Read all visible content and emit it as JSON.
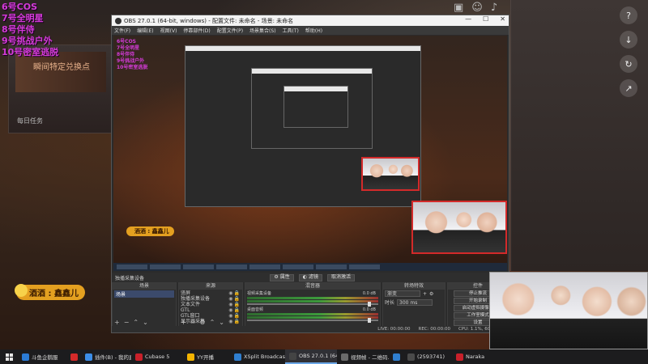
{
  "overlay_list": [
    "6号COS",
    "7号全明星",
    "8号伴侍",
    "9号挑战户外",
    "10号密室逃脱"
  ],
  "name_tag": "酒酒 : 鑫鑫儿",
  "bg_room": {
    "poster_text": "瞬间特定兑换点",
    "small_label": "每日任务"
  },
  "obs": {
    "title": "OBS 27.0.1 (64-bit, windows) - 配置文件: 未命名 - 场景: 未命名",
    "menu": [
      "文件(F)",
      "编辑(E)",
      "视图(V)",
      "停靠部件(D)",
      "配置文件(P)",
      "场景集合(S)",
      "工具(T)",
      "帮助(H)"
    ],
    "toolbar": {
      "label": "独播采集设备",
      "properties": "属性",
      "filters": "滤镜",
      "deactivate": "取消激活"
    },
    "docks": {
      "scenes": {
        "header": "场景",
        "items": [
          "场景"
        ]
      },
      "sources": {
        "header": "来源",
        "items": [
          "竖屏",
          "独播采集设备",
          "文本文件",
          "GTL",
          "GTL窗口",
          "显示器采集"
        ]
      },
      "mixer": {
        "header": "混音器",
        "tracks": [
          {
            "name": "视频采集设备",
            "db": "0.0 dB"
          },
          {
            "name": "桌面音频",
            "db": "0.0 dB"
          }
        ]
      },
      "transitions": {
        "header": "转场特效",
        "type": "渐变",
        "duration_label": "时长",
        "duration": "300 ms"
      },
      "controls": {
        "header": "控件",
        "buttons": [
          "停止推流",
          "开始录制",
          "启动虚拟摄像机",
          "工作室模式",
          "设置",
          "退出"
        ]
      }
    },
    "status": {
      "live": "LIVE: 00:00:00",
      "rec": "REC: 00:00:00",
      "cpu": "CPU: 1.1%, 60.00 fps"
    }
  },
  "taskbar": [
    {
      "label": "斗鱼企鹅服",
      "color": "#2b7cd6"
    },
    {
      "label": "",
      "color": "#d32a2a"
    },
    {
      "label": "插件(B) - 我的直...",
      "color": "#3c8ee8"
    },
    {
      "label": "Cubase 5",
      "color": "#c8202a"
    },
    {
      "label": "YY开播",
      "color": "#f4b400"
    },
    {
      "label": "XSplit Broadcas...",
      "color": "#2f7fd0"
    },
    {
      "label": "OBS 27.0.1 (64...",
      "color": "#444"
    },
    {
      "label": "视频帧 - 二维码...",
      "color": "#6a6a6a"
    },
    {
      "label": "",
      "color": "#2f7fd0"
    },
    {
      "label": "(2593741)",
      "color": "#4a4a4a"
    },
    {
      "label": "Naraka",
      "color": "#c8202a"
    }
  ],
  "right_icons": [
    "?",
    "↓",
    "↻",
    "↗"
  ]
}
